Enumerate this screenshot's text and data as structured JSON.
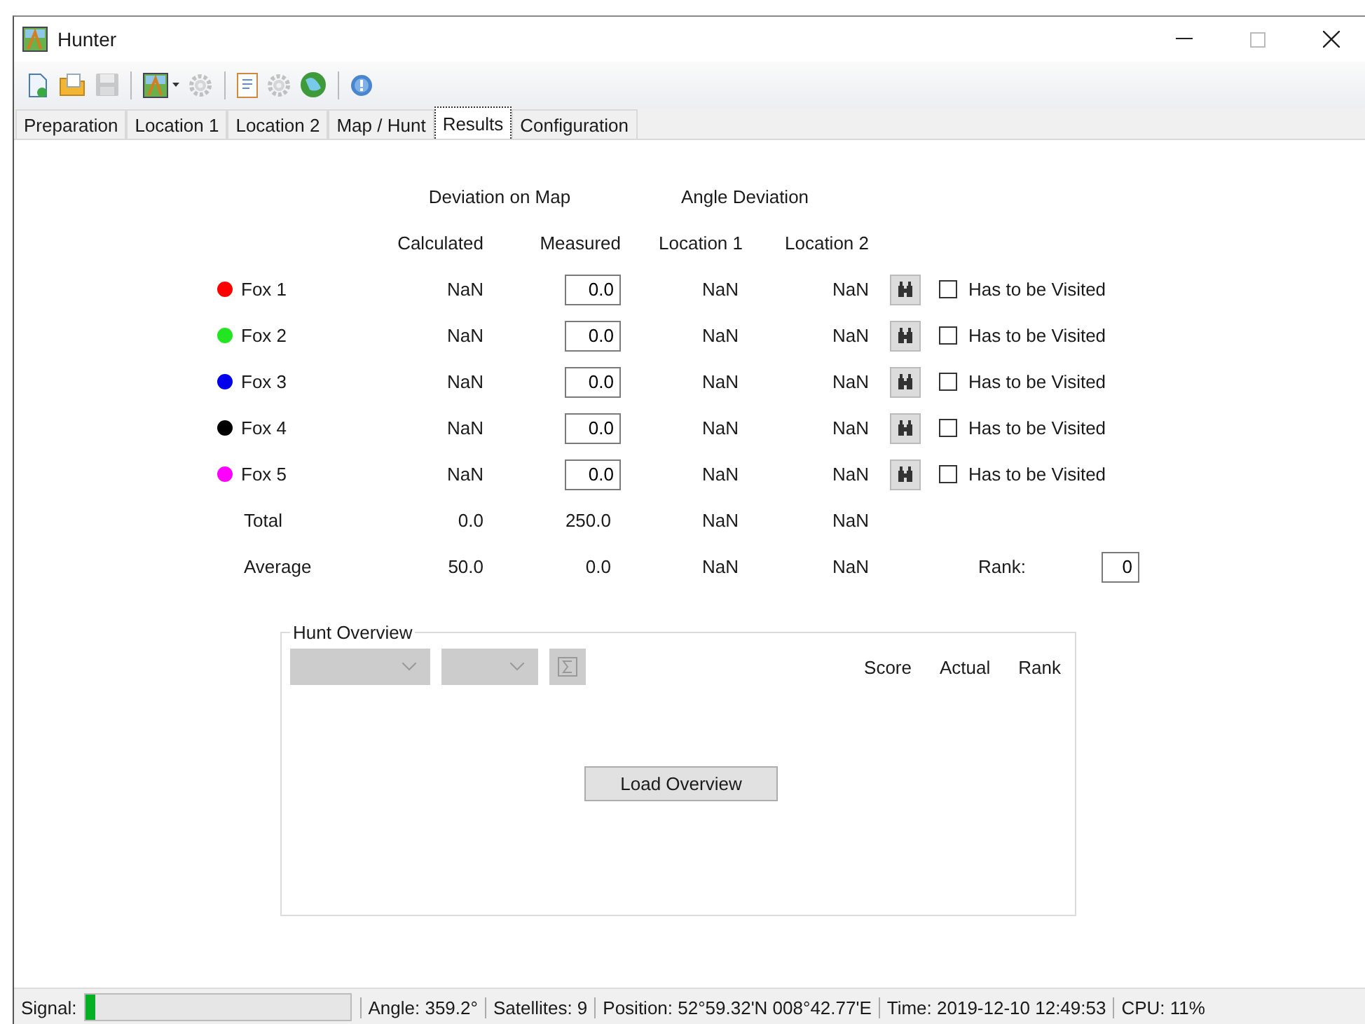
{
  "window": {
    "title": "Hunter"
  },
  "toolbar": [
    {
      "kind": "new",
      "disabled": false
    },
    {
      "kind": "open",
      "disabled": false
    },
    {
      "kind": "save",
      "disabled": true
    },
    {
      "kind": "separator"
    },
    {
      "kind": "map",
      "disabled": false
    },
    {
      "kind": "gear",
      "disabled": true
    },
    {
      "kind": "separator"
    },
    {
      "kind": "notes",
      "disabled": false
    },
    {
      "kind": "cog",
      "disabled": true
    },
    {
      "kind": "globe",
      "disabled": false
    },
    {
      "kind": "separator"
    },
    {
      "kind": "help",
      "disabled": false
    }
  ],
  "tabs": [
    {
      "label": "Preparation",
      "selected": false
    },
    {
      "label": "Location 1",
      "selected": false
    },
    {
      "label": "Location 2",
      "selected": false
    },
    {
      "label": "Map / Hunt",
      "selected": false
    },
    {
      "label": "Results",
      "selected": true
    },
    {
      "label": "Configuration",
      "selected": false
    }
  ],
  "results": {
    "groups": [
      "Deviation on Map",
      "Angle Deviation"
    ],
    "columns": [
      "Calculated",
      "Measured",
      "Location 1",
      "Location 2"
    ],
    "rows": [
      {
        "kind": "fox",
        "color": "#ff0000",
        "name": "Fox 1",
        "calculated": "NaN",
        "measured": "0.0",
        "location_1": "NaN",
        "location_2": "NaN",
        "visit": {
          "label": "Has to be Visited",
          "checked": false
        }
      },
      {
        "kind": "fox",
        "color": "#22e622",
        "name": "Fox 2",
        "calculated": "NaN",
        "measured": "0.0",
        "location_1": "NaN",
        "location_2": "NaN",
        "visit": {
          "label": "Has to be Visited",
          "checked": false
        }
      },
      {
        "kind": "fox",
        "color": "#0000ee",
        "name": "Fox 3",
        "calculated": "NaN",
        "measured": "0.0",
        "location_1": "NaN",
        "location_2": "NaN",
        "visit": {
          "label": "Has to be Visited",
          "checked": false
        }
      },
      {
        "kind": "fox",
        "color": "#000000",
        "name": "Fox 4",
        "calculated": "NaN",
        "measured": "0.0",
        "location_1": "NaN",
        "location_2": "NaN",
        "visit": {
          "label": "Has to be Visited",
          "checked": false
        }
      },
      {
        "kind": "fox",
        "color": "#ff00ff",
        "name": "Fox 5",
        "calculated": "NaN",
        "measured": "0.0",
        "location_1": "NaN",
        "location_2": "NaN",
        "visit": {
          "label": "Has to be Visited",
          "checked": false
        }
      },
      {
        "kind": "summary",
        "name": "Total",
        "calculated": "0.0",
        "measured": "250.0",
        "location_1": "NaN",
        "location_2": "NaN"
      },
      {
        "kind": "summary",
        "name": "Average",
        "calculated": "50.0",
        "measured": "0.0",
        "location_1": "NaN",
        "location_2": "NaN"
      }
    ],
    "rank": {
      "label": "Rank:",
      "value": "0"
    }
  },
  "hunt_overview": {
    "title": "Hunt Overview",
    "columns": [
      "Score",
      "Actual",
      "Rank"
    ],
    "load_button": "Load Overview"
  },
  "status_bar": {
    "signal": {
      "label": "Signal:",
      "level": 0.04
    },
    "items": [
      "Angle: 359.2°",
      "Satellites: 9",
      "Position: 52°59.32'N 008°42.77'E",
      "Time: 2019-12-10 12:49:53",
      "CPU: 11%"
    ]
  }
}
